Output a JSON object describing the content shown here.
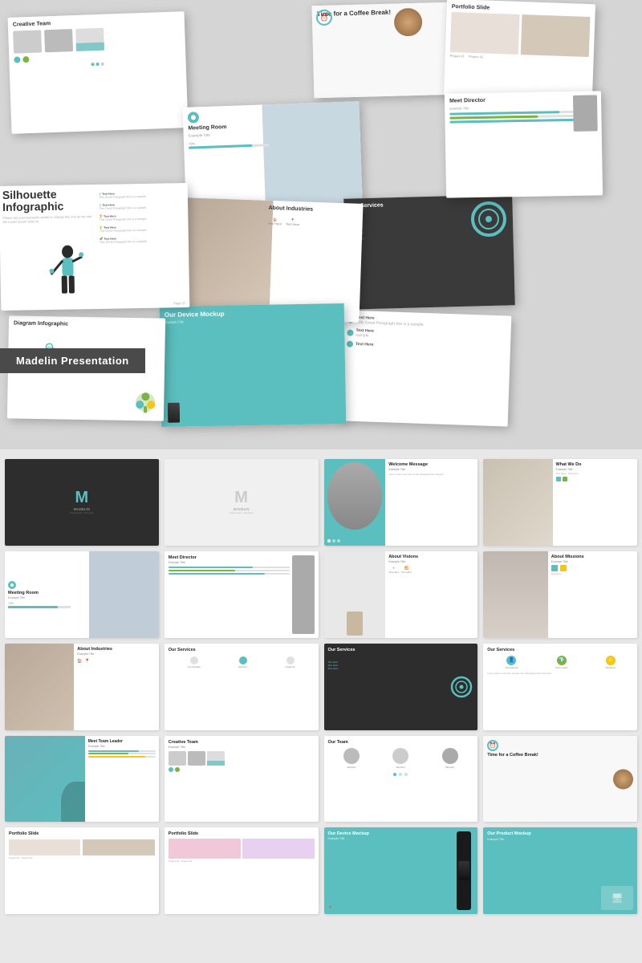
{
  "app": {
    "title": "Madelin Presentation Template"
  },
  "banner": {
    "label": "Madelin Presentation"
  },
  "top_slides": [
    {
      "id": "s1",
      "title": "Creative Team",
      "type": "team"
    },
    {
      "id": "s2",
      "title": "Time for a Coffee Break!",
      "type": "coffee"
    },
    {
      "id": "s3",
      "title": "Portfolio Slide",
      "type": "portfolio"
    },
    {
      "id": "s4",
      "title": "Meet Director",
      "type": "director"
    },
    {
      "id": "s5",
      "title": "Meeting Room",
      "type": "room"
    },
    {
      "id": "s6",
      "title": "Silhouette Infographic",
      "type": "infographic"
    },
    {
      "id": "s7",
      "title": "About Industries",
      "type": "industries"
    },
    {
      "id": "s8",
      "title": "Our Services",
      "type": "services"
    },
    {
      "id": "s9",
      "title": "Diagram Infographic",
      "type": "diagram"
    },
    {
      "id": "s10",
      "title": "Our Device Mockup",
      "type": "device"
    },
    {
      "id": "s11",
      "title": "Text Here items",
      "type": "text_items"
    }
  ],
  "bottom_rows": [
    {
      "row": 1,
      "thumbs": [
        {
          "title": "MADELIN",
          "subtitle": "Presentation Template",
          "type": "dark_logo"
        },
        {
          "title": "MADELIN",
          "subtitle": "Presentation Template",
          "type": "light_logo"
        },
        {
          "title": "Welcome Message",
          "subtitle": "Example Title",
          "type": "welcome"
        },
        {
          "title": "What We Do",
          "subtitle": "Example Title",
          "type": "whatwedo"
        }
      ]
    },
    {
      "row": 2,
      "thumbs": [
        {
          "title": "Meeting Room",
          "subtitle": "Example Title",
          "type": "meetroom"
        },
        {
          "title": "Meet Director",
          "subtitle": "Example Title",
          "type": "meetdir"
        },
        {
          "title": "About Visions",
          "subtitle": "Example Title",
          "type": "visions"
        },
        {
          "title": "About Missions",
          "subtitle": "Example Title",
          "type": "missions"
        }
      ]
    },
    {
      "row": 3,
      "thumbs": [
        {
          "title": "About Industries",
          "subtitle": "Example Title",
          "type": "industries2"
        },
        {
          "title": "Our Services",
          "subtitle": "",
          "type": "services_white"
        },
        {
          "title": "Our Services",
          "subtitle": "",
          "type": "services_dark"
        },
        {
          "title": "Our Services",
          "subtitle": "",
          "type": "services_icons"
        }
      ]
    },
    {
      "row": 4,
      "thumbs": [
        {
          "title": "Meet Team Leader",
          "subtitle": "Example Title",
          "type": "teamlead"
        },
        {
          "title": "Creative Team",
          "subtitle": "Example Title",
          "type": "creativeteam"
        },
        {
          "title": "Our Team",
          "subtitle": "",
          "type": "ourteam"
        },
        {
          "title": "Time for a Coffee Break!",
          "subtitle": "",
          "type": "coffee2"
        }
      ]
    },
    {
      "row": 5,
      "thumbs": [
        {
          "title": "Portfolio Slide",
          "subtitle": "",
          "type": "port1"
        },
        {
          "title": "Portfolio Slide",
          "subtitle": "",
          "type": "port2"
        },
        {
          "title": "Our Device Mockup",
          "subtitle": "Example Title",
          "type": "devicemock"
        },
        {
          "title": "Our Product Mockup",
          "subtitle": "Example Title",
          "type": "productmock"
        }
      ]
    }
  ],
  "colors": {
    "teal": "#5bbfbf",
    "dark": "#2d2d2d",
    "green": "#7cb342",
    "yellow": "#f5c518",
    "gray": "#888888",
    "light_gray": "#f0f0f0"
  },
  "labels": {
    "text_here": "Text Here",
    "example_title": "Example Title",
    "example_text": "This Great Paragraph line is a sample",
    "madelin": "MADELIN",
    "page_27": "Page 27"
  }
}
